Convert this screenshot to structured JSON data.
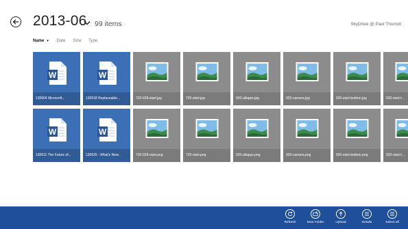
{
  "header": {
    "folder_title": "2013-06",
    "item_count": "99 items",
    "account": "SkyDrive @ Paul Thurrott"
  },
  "sort": {
    "options": [
      {
        "label": "Name",
        "active": true
      },
      {
        "label": "Date",
        "active": false
      },
      {
        "label": "Size",
        "active": false
      },
      {
        "label": "Type",
        "active": false
      }
    ]
  },
  "files": {
    "row1": [
      {
        "name": "130604 Microsoft...",
        "kind": "word-document"
      },
      {
        "name": "130618 Replaceable...",
        "kind": "word-document"
      },
      {
        "name": "720-928-start.jpg",
        "kind": "image"
      },
      {
        "name": "720-start.jpg",
        "kind": "image"
      },
      {
        "name": "920-allapps.jpg",
        "kind": "image"
      },
      {
        "name": "920-camera.jpg",
        "kind": "image"
      },
      {
        "name": "920-start-bottom.jpg",
        "kind": "image"
      },
      {
        "name": "920-start-to...",
        "kind": "image"
      }
    ],
    "row2": [
      {
        "name": "130611 The Future of...",
        "kind": "word-document"
      },
      {
        "name": "130625 - What's New...",
        "kind": "word-document"
      },
      {
        "name": "720-928-start.png",
        "kind": "image"
      },
      {
        "name": "720-start.png",
        "kind": "image"
      },
      {
        "name": "920-allapps.png",
        "kind": "image"
      },
      {
        "name": "920-camera.png",
        "kind": "image"
      },
      {
        "name": "920-start-bottom.png",
        "kind": "image"
      },
      {
        "name": "920-start-to...",
        "kind": "image"
      }
    ]
  },
  "appbar": {
    "commands": [
      {
        "label": "Refresh",
        "icon": "refresh-icon"
      },
      {
        "label": "New Folder",
        "icon": "new-folder-icon"
      },
      {
        "label": "Upload",
        "icon": "upload-icon"
      },
      {
        "label": "Details",
        "icon": "details-icon"
      },
      {
        "label": "Select all",
        "icon": "select-all-icon"
      }
    ]
  },
  "colors": {
    "doc_tile": "#3b6fb6",
    "image_tile": "#8c8c8c",
    "appbar": "#1f4e9b"
  }
}
